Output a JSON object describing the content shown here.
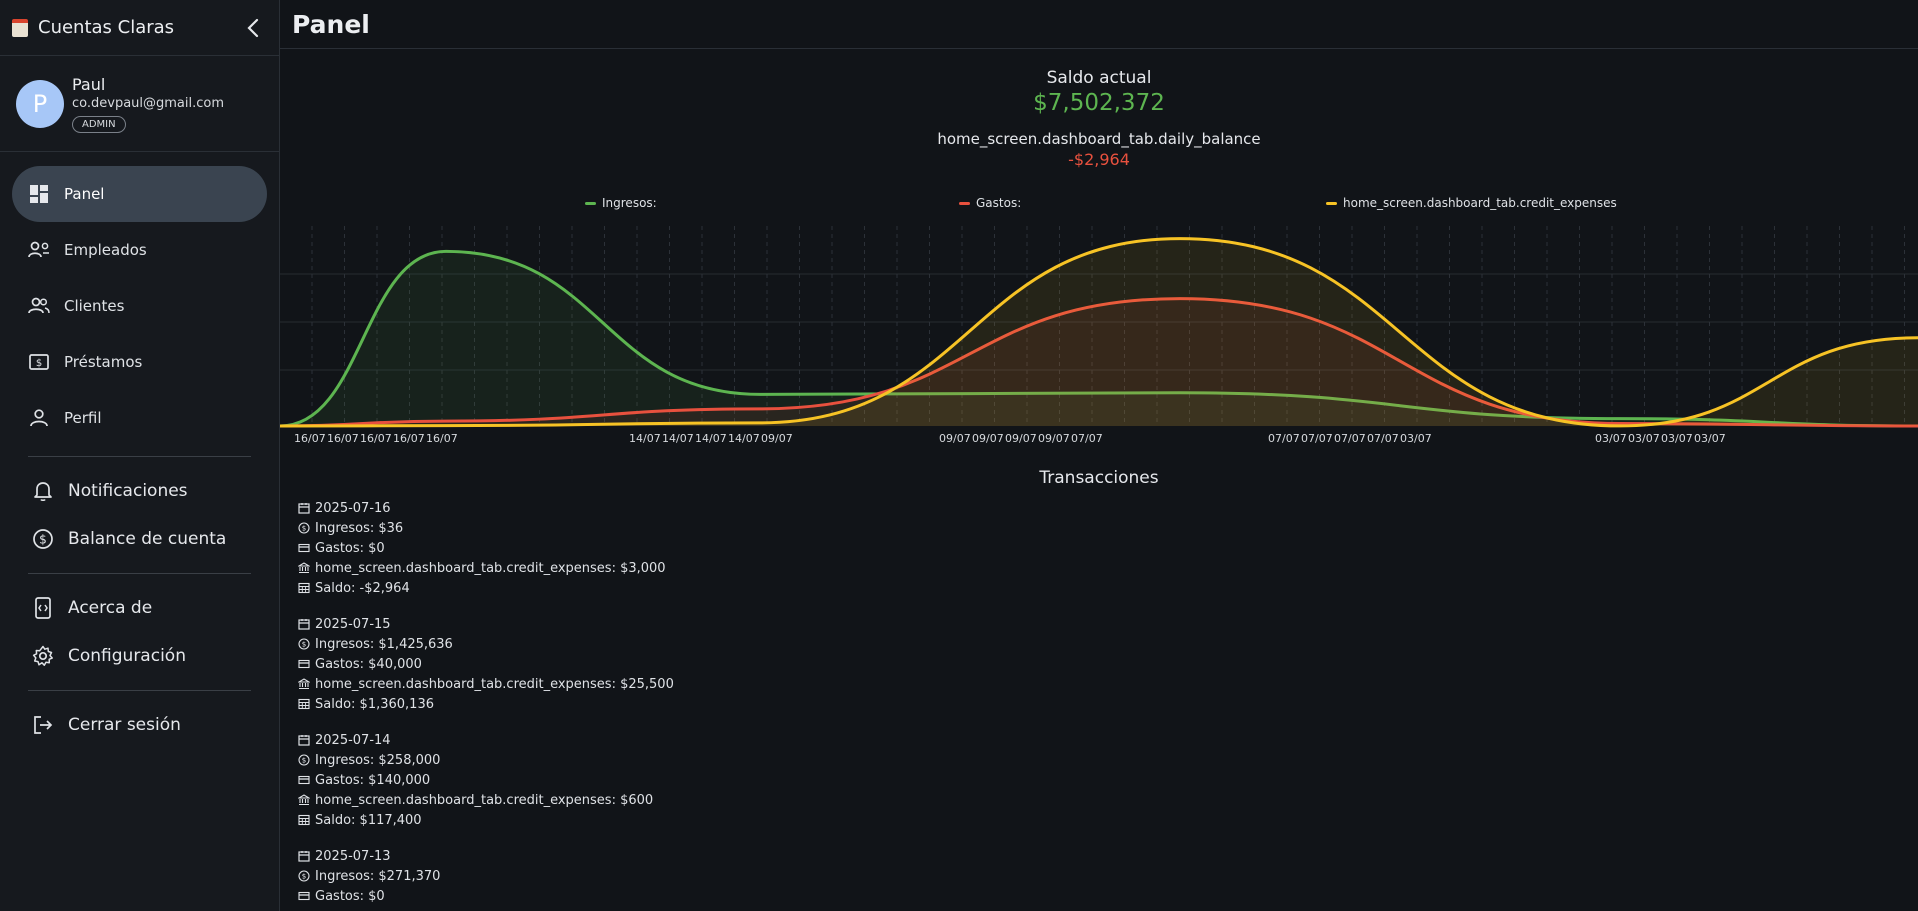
{
  "app": {
    "title": "Cuentas Claras"
  },
  "user": {
    "initial": "P",
    "name": "Paul",
    "email": "co.devpaul@gmail.com",
    "role": "ADMIN"
  },
  "nav": [
    {
      "label": "Panel",
      "icon": "dashboard-icon",
      "active": true
    },
    {
      "label": "Empleados",
      "icon": "employees-icon",
      "active": false
    },
    {
      "label": "Clientes",
      "icon": "clients-icon",
      "active": false
    },
    {
      "label": "Préstamos",
      "icon": "loans-icon",
      "active": false
    },
    {
      "label": "Perfil",
      "icon": "profile-icon",
      "active": false
    }
  ],
  "secondary": [
    {
      "label": "Notificaciones",
      "icon": "bell-icon"
    },
    {
      "label": "Balance de cuenta",
      "icon": "dollar-circle-icon"
    }
  ],
  "tertiary": [
    {
      "label": "Acerca de",
      "icon": "about-icon"
    },
    {
      "label": "Configuración",
      "icon": "gear-icon"
    }
  ],
  "logout": {
    "label": "Cerrar sesión",
    "icon": "logout-icon"
  },
  "page": {
    "title": "Panel"
  },
  "summary": {
    "saldo_label": "Saldo actual",
    "saldo_value": "$7,502,372",
    "daily_label": "home_screen.dashboard_tab.daily_balance",
    "daily_value": "-$2,964"
  },
  "colors": {
    "ingresos": "#5db550",
    "gastos": "#e8513e",
    "credit": "#f7c325",
    "accent_negative": "#e8513e",
    "accent_positive": "#5db550"
  },
  "chart_data": {
    "type": "area",
    "legend": [
      {
        "name": "Ingresos:",
        "color": "#5db550"
      },
      {
        "name": "Gastos:",
        "color": "#e8513e"
      },
      {
        "name": "home_screen.dashboard_tab.credit_expenses",
        "color": "#f7c325"
      }
    ],
    "x_tick_labels": [
      "16/07",
      "16/07",
      "16/07",
      "16/07",
      "16/07",
      "14/07",
      "14/07",
      "14/07",
      "14/07",
      "09/07",
      "09/07",
      "09/07",
      "09/07",
      "09/07",
      "07/07",
      "07/07",
      "07/07",
      "07/07",
      "07/07",
      "03/07",
      "03/07",
      "03/07",
      "03/07",
      "03/07"
    ],
    "series": [
      {
        "name": "Ingresos:",
        "x": [
          0,
          1,
          2,
          3,
          4,
          5
        ],
        "y": [
          0,
          1425636,
          258000,
          271370,
          60000,
          0
        ]
      },
      {
        "name": "Gastos:",
        "x": [
          0,
          1,
          2,
          3,
          4,
          5
        ],
        "y": [
          0,
          40000,
          140000,
          1040000,
          20000,
          0
        ]
      },
      {
        "name": "home_screen.dashboard_tab.credit_expenses",
        "x": [
          0,
          1,
          2,
          3,
          4,
          5
        ],
        "y": [
          0,
          3000,
          25500,
          1530000,
          600,
          720000
        ]
      }
    ],
    "grid": true
  },
  "transactions": {
    "title": "Transacciones",
    "groups": [
      {
        "date": "2025-07-16",
        "ingresos": "Ingresos: $36",
        "gastos": "Gastos: $0",
        "credit": "home_screen.dashboard_tab.credit_expenses: $3,000",
        "saldo": "Saldo: -$2,964"
      },
      {
        "date": "2025-07-15",
        "ingresos": "Ingresos: $1,425,636",
        "gastos": "Gastos: $40,000",
        "credit": "home_screen.dashboard_tab.credit_expenses: $25,500",
        "saldo": "Saldo: $1,360,136"
      },
      {
        "date": "2025-07-14",
        "ingresos": "Ingresos: $258,000",
        "gastos": "Gastos: $140,000",
        "credit": "home_screen.dashboard_tab.credit_expenses: $600",
        "saldo": "Saldo: $117,400"
      },
      {
        "date": "2025-07-13",
        "ingresos": "Ingresos: $271,370",
        "gastos": "Gastos: $0"
      }
    ]
  }
}
